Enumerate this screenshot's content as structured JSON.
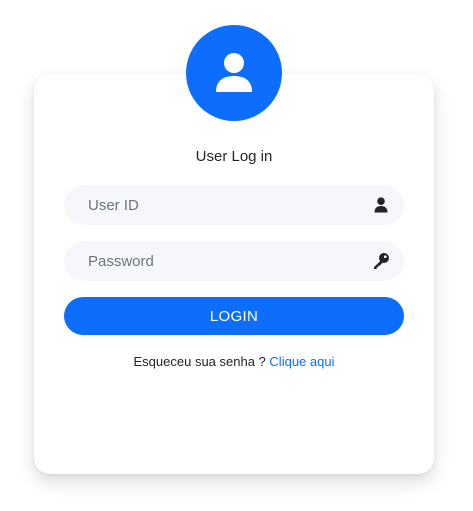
{
  "header": {
    "title": "User Log in",
    "avatar_icon": "user-icon"
  },
  "form": {
    "user_id": {
      "value": "",
      "placeholder": "User ID",
      "icon": "user-icon"
    },
    "password": {
      "value": "",
      "placeholder": "Password",
      "icon": "key-icon"
    },
    "login_label": "LOGIN"
  },
  "footer": {
    "forgot_text": "Esqueceu sua senha ?",
    "forgot_link": "Clique aqui"
  },
  "colors": {
    "accent": "#0d6efd",
    "field_bg": "#f5f7fa",
    "text": "#212529"
  }
}
